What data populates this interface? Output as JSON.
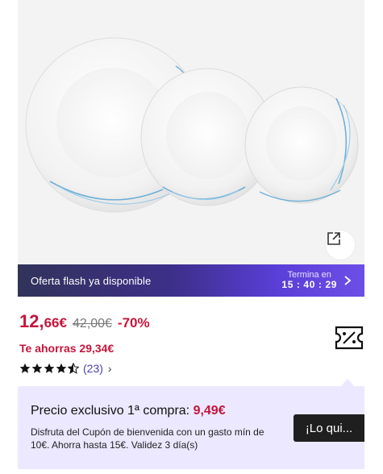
{
  "product_image": {
    "alt_icon": "share-icon"
  },
  "flash_bar": {
    "label": "Oferta flash ya disponible",
    "timer_label": "Termina en",
    "timer": "15 : 40 : 29"
  },
  "price": {
    "int": "12,",
    "dec": "66€",
    "old": "42,00€",
    "discount": "-70%",
    "savings": "Te ahorras 29,34€"
  },
  "rating": {
    "stars": 4.5,
    "count": "(23)",
    "chevron": "›"
  },
  "promo": {
    "title_prefix": "Precio exclusivo 1ª compra: ",
    "title_price": "9,49€",
    "description": "Disfruta del Cupón de bienvenida con un gasto mín de 10€. Ahorra hasta 15€. Validez 3 día(s)",
    "button": "¡Lo qui..."
  },
  "colors": {
    "accent_red": "#c4163c",
    "flash_bar": "#4a39c6",
    "promo_bg": "#ebe8ff"
  }
}
